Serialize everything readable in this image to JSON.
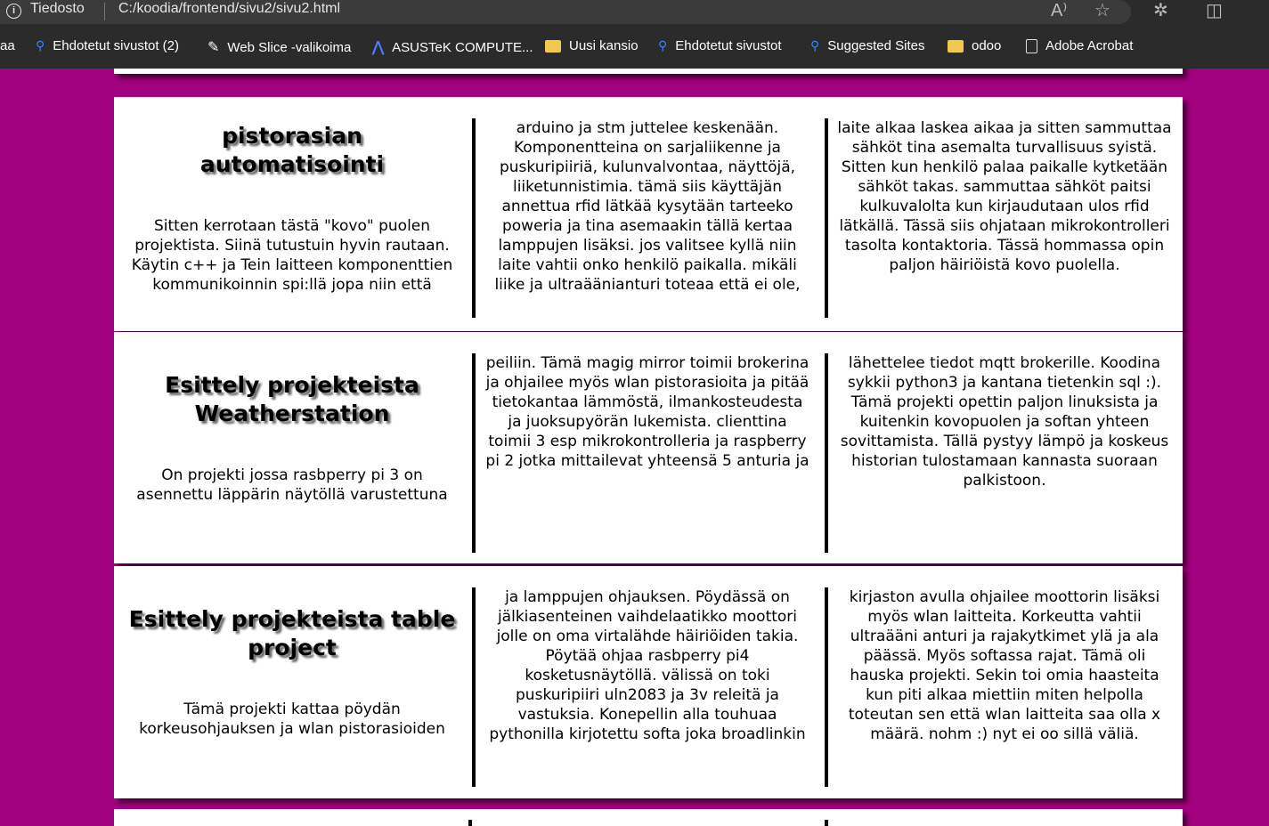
{
  "browser": {
    "site_label": "Tiedosto",
    "url": "C:/koodia/frontend/sivu2/sivu2.html",
    "icons": [
      "info-icon",
      "read-aloud-icon",
      "favorite-star-icon",
      "extensions-icon",
      "split-screen-icon"
    ]
  },
  "bookmarks": [
    {
      "label": "aa",
      "icon": "none"
    },
    {
      "label": "Ehdotetut sivustot (2)",
      "icon": "search-icon"
    },
    {
      "label": "Web Slice -valikoima",
      "icon": "web-slice-icon"
    },
    {
      "label": "ASUSTeK COMPUTE...",
      "icon": "asus-icon"
    },
    {
      "label": "Uusi kansio",
      "icon": "folder-icon"
    },
    {
      "label": "Ehdotetut sivustot",
      "icon": "search-icon"
    },
    {
      "label": "Suggested Sites",
      "icon": "search-icon"
    },
    {
      "label": "odoo",
      "icon": "folder-icon"
    },
    {
      "label": "Adobe Acrobat",
      "icon": "document-icon"
    }
  ],
  "page": {
    "background_color": "#a3027f",
    "projects": [
      {
        "title": "pistorasian automatisointi",
        "desc": "Sitten kerrotaan tästä \"kovo\" puolen projektista. Siinä tutustuin hyvin rautaan. Käytin c++ ja Tein laitteen komponenttien kommunikoinnin spi:llä jopa niin että",
        "col2": "arduino ja stm juttelee keskenään. Komponentteina on sarjaliikenne ja puskuripiiriä, kulunvalvontaa, näyttöjä, liiketunnistimia. tämä siis käyttäjän annettua rfid lätkää kysytään tarteeko poweria ja tina asemaakin tällä kertaa lamppujen lisäksi. jos valitsee kyllä niin laite vahtii onko henkilö paikalla. mikäli liike ja ultraäänianturi toteaa että ei ole,",
        "col3": "laite alkaa laskea aikaa ja sitten sammuttaa sähköt tina asemalta turvallisuus syistä. Sitten kun henkilö palaa paikalle kytketään sähköt takas. sammuttaa sähköt paitsi kulkuvalolta kun kirjaudutaan ulos rfid lätkällä. Tässä siis ohjataan mikrokontrolleri tasolta kontaktoria. Tässä hommassa opin paljon häiriöistä kovo puolella."
      },
      {
        "title": "Esittely projekteista Weatherstation",
        "desc": "On projekti jossa rasbperry pi 3 on asennettu läppärin näytöllä varustettuna",
        "col2": "peiliin. Tämä magig mirror toimii brokerina ja ohjailee myös wlan pistorasioita ja pitää tietokantaa lämmöstä, ilmankosteudesta ja juoksupyörän lukemista. clienttina toimii 3 esp mikrokontrolleria ja raspberry pi 2 jotka mittailevat yhteensä 5 anturia ja",
        "col3": "lähettelee tiedot mqtt brokerille. Koodina sykkii python3 ja kantana tietenkin sql :). Tämä projekti opettin paljon linuksista ja kuitenkin kovopuolen ja softan yhteen sovittamista. Tällä pystyy lämpö ja koskeus historian tulostamaan kannasta suoraan palkistoon."
      },
      {
        "title": "Esittely projekteista table project",
        "desc": "Tämä projekti kattaa pöydän korkeusohjauksen ja wlan pistorasioiden",
        "col2": "ja lamppujen ohjauksen. Pöydässä on jälkiasenteinen vaihdelaatikko moottori jolle on oma virtalähde häiriöiden takia. Pöytää ohjaa rasbperry pi4 kosketusnäytöllä. välissä on toki puskuripiiri uln2083 ja 3v releitä ja vastuksia. Konepellin alla touhuaa pythonilla kirjotettu softa joka broadlinkin",
        "col3": "kirjaston avulla ohjailee moottorin lisäksi myös wlan laitteita. Korkeutta vahtii ultraääni anturi ja rajakytkimet ylä ja ala päässä. Myös softassa rajat. Tämä oli hauska projekti. Sekin toi omia haasteita kun piti alkaa miettiin miten helpolla toteutan sen että wlan laitteita saa olla x määrä. nohm :) nyt ei oo sillä väliä."
      }
    ]
  }
}
